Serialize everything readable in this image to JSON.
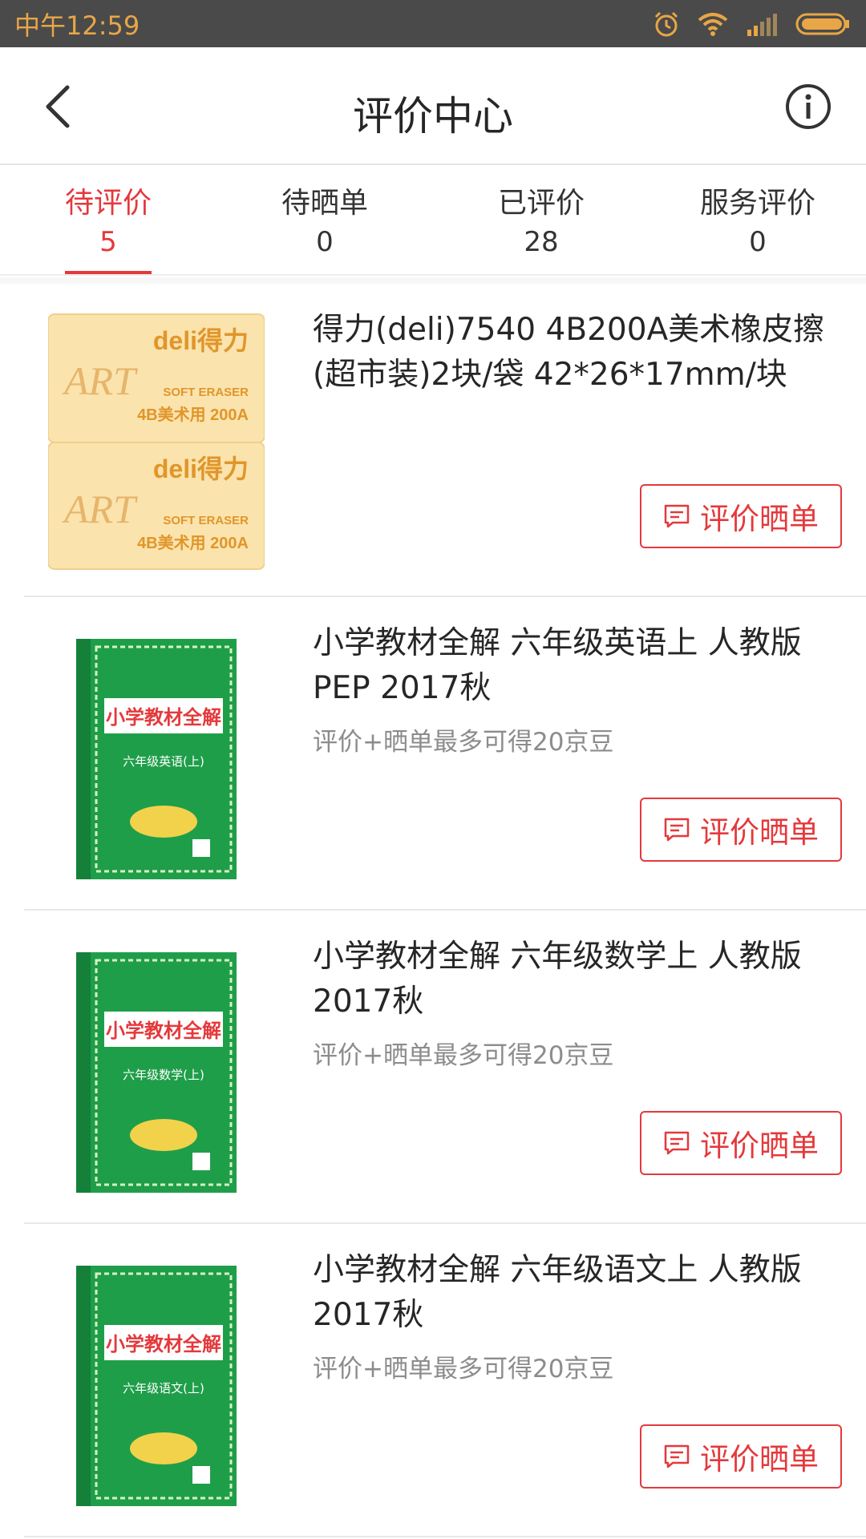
{
  "status_bar": {
    "time": "中午12:59",
    "icons": [
      "alarm-icon",
      "wifi-icon",
      "signal-icon",
      "battery-icon"
    ]
  },
  "header": {
    "title": "评价中心",
    "back_icon": "chevron-left-icon",
    "info_icon": "info-icon"
  },
  "tabs": [
    {
      "label": "待评价",
      "count": "5",
      "active": true
    },
    {
      "label": "待晒单",
      "count": "0",
      "active": false
    },
    {
      "label": "已评价",
      "count": "28",
      "active": false
    },
    {
      "label": "服务评价",
      "count": "0",
      "active": false
    }
  ],
  "items": [
    {
      "title_line1": "得力(deli)7540 4B200A美术橡皮擦",
      "title_line2": "(超市装)2块/袋 42*26*17mm/块",
      "hint": "",
      "button_label": "评价晒单",
      "thumb": {
        "brand": "deli得力",
        "script": "ART",
        "sub": "SOFT ERASER",
        "spec": "4B美术用 200A"
      }
    },
    {
      "title_line1": "小学教材全解 六年级英语上 人教版",
      "title_line2": "PEP 2017秋",
      "hint": "评价+晒单最多可得20京豆",
      "button_label": "评价晒单",
      "thumb": {
        "book_title": "小学教材全解",
        "grade": "六年级英语(上)"
      }
    },
    {
      "title_line1": "小学教材全解 六年级数学上 人教版",
      "title_line2": "2017秋",
      "hint": "评价+晒单最多可得20京豆",
      "button_label": "评价晒单",
      "thumb": {
        "book_title": "小学教材全解",
        "grade": "六年级数学(上)"
      }
    },
    {
      "title_line1": "小学教材全解 六年级语文上 人教版",
      "title_line2": "2017秋",
      "hint": "评价+晒单最多可得20京豆",
      "button_label": "评价晒单",
      "thumb": {
        "book_title": "小学教材全解",
        "grade": "六年级语文(上)"
      }
    }
  ],
  "colors": {
    "accent": "#e4393c",
    "status_bar": "#4a4a4a",
    "status_text": "#e8a646",
    "book_green": "#1f9e4a"
  }
}
